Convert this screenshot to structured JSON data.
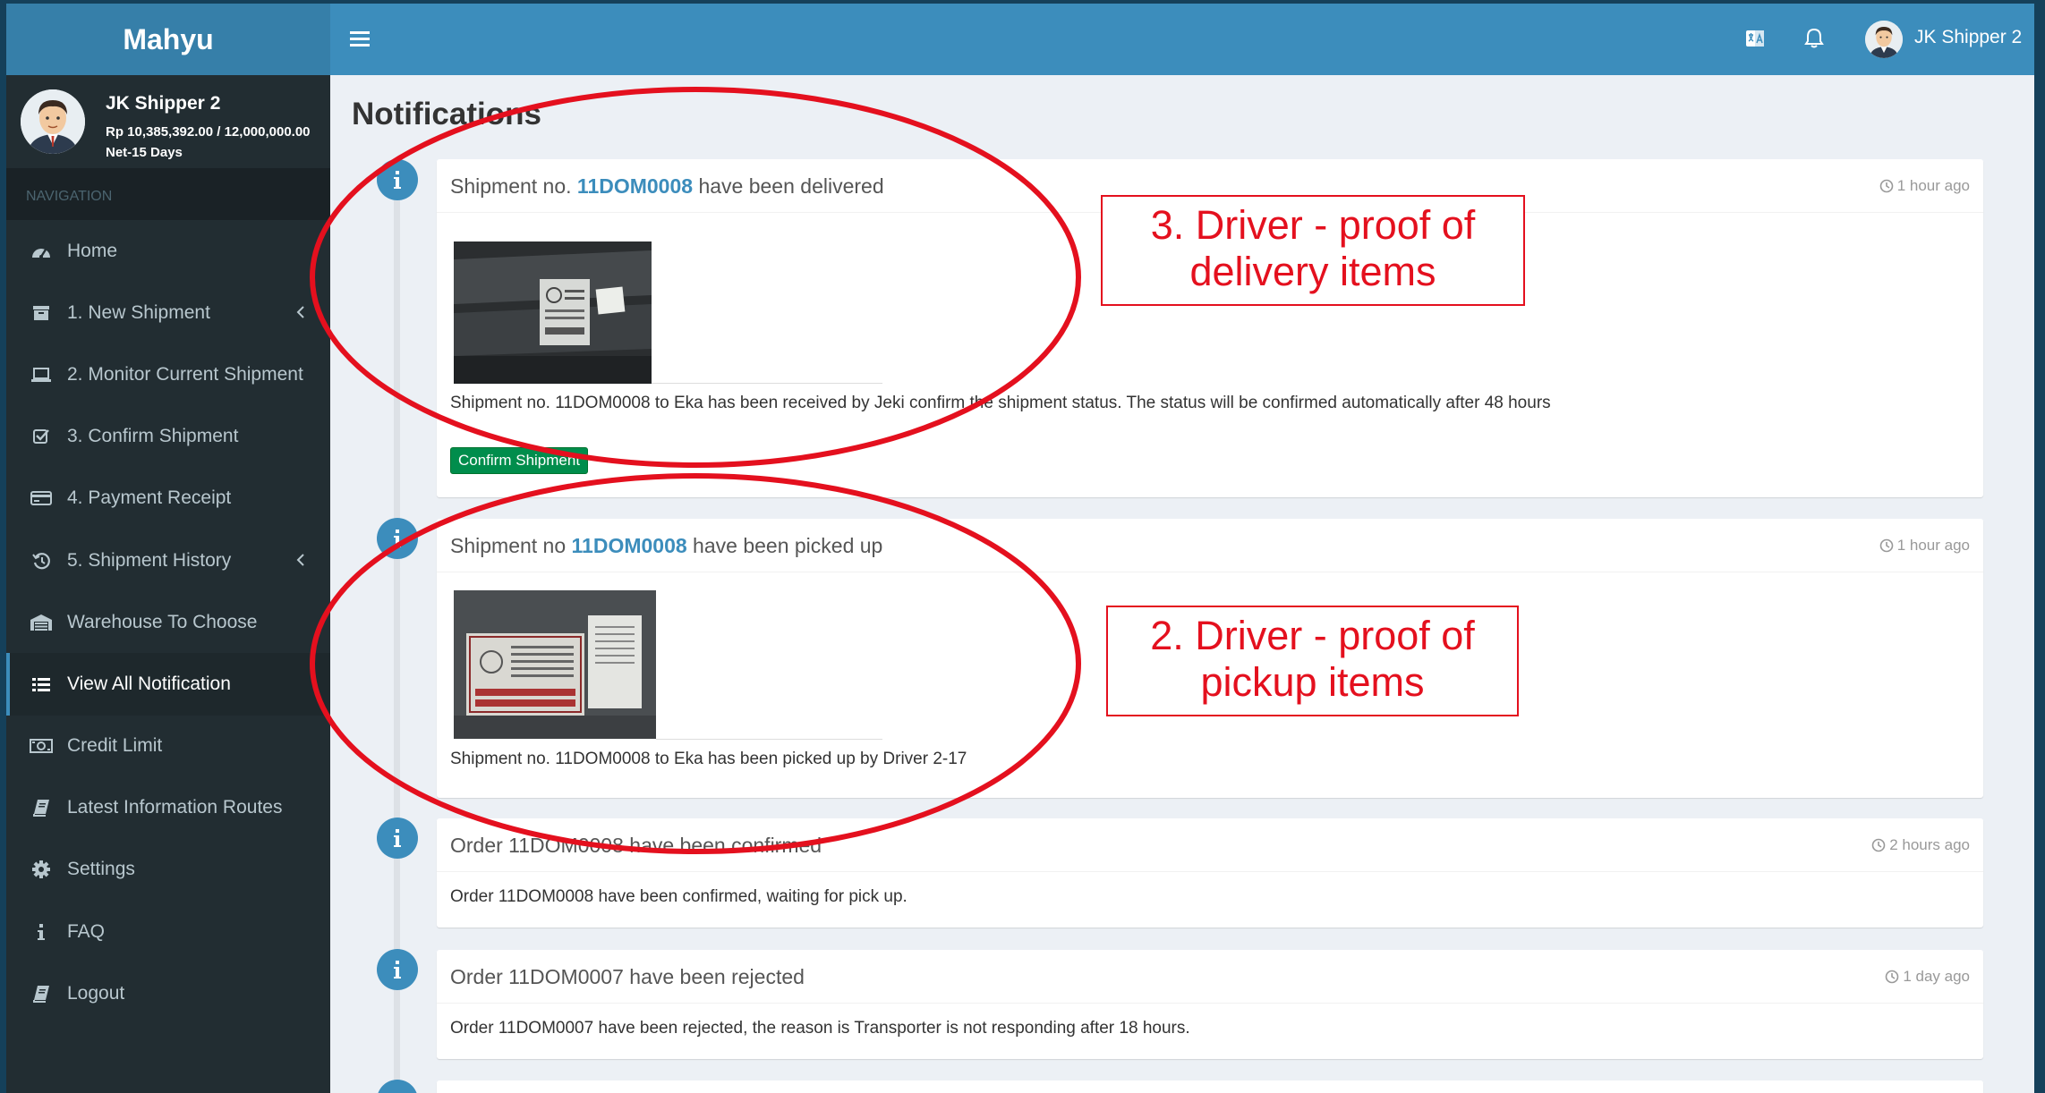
{
  "app": {
    "title": "Mahyu"
  },
  "user_panel": {
    "name": "JK Shipper 2",
    "credit": "Rp 10,385,392.00 / 12,000,000.00",
    "terms": "Net-15 Days"
  },
  "sidebar": {
    "header": "NAVIGATION",
    "items": [
      {
        "label": "Home",
        "icon": "dashboard-icon"
      },
      {
        "label": "1. New Shipment",
        "icon": "archive-icon",
        "chevron": true
      },
      {
        "label": "2. Monitor Current Shipment",
        "icon": "laptop-icon"
      },
      {
        "label": "3. Confirm Shipment",
        "icon": "check-square-icon"
      },
      {
        "label": "4. Payment Receipt",
        "icon": "credit-card-icon"
      },
      {
        "label": "5. Shipment History",
        "icon": "history-icon",
        "chevron": true
      },
      {
        "label": "Warehouse To Choose",
        "icon": "warehouse-icon"
      },
      {
        "label": "View All Notification",
        "icon": "list-icon",
        "active": true
      },
      {
        "label": "Credit Limit",
        "icon": "money-icon"
      },
      {
        "label": "Latest Information Routes",
        "icon": "book-icon"
      },
      {
        "label": "Settings",
        "icon": "gear-icon"
      },
      {
        "label": "FAQ",
        "icon": "info-icon"
      },
      {
        "label": "Logout",
        "icon": "book-icon"
      }
    ]
  },
  "topbar": {
    "username": "JK Shipper 2"
  },
  "page": {
    "title": "Notifications"
  },
  "notifications": [
    {
      "title_prefix": "Shipment no. ",
      "shipment_id": "11DOM0008",
      "title_suffix": " have been delivered",
      "time": "1 hour ago",
      "text": "Shipment no. 11DOM0008 to Eka has been received by Jeki confirm the shipment status. The status will be confirmed automatically after 48 hours",
      "button": "Confirm Shipment"
    },
    {
      "title_prefix": "Shipment no ",
      "shipment_id": "11DOM0008",
      "title_suffix": " have been picked up",
      "time": "1 hour ago",
      "text": "Shipment no. 11DOM0008 to Eka has been picked up by Driver 2-17"
    },
    {
      "title": "Order 11DOM0008 have been confirmed",
      "time": "2 hours ago",
      "text": "Order 11DOM0008 have been confirmed, waiting for pick up."
    },
    {
      "title": "Order 11DOM0007 have been rejected",
      "time": "1 day ago",
      "text": "Order 11DOM0007 have been rejected, the reason is Transporter is not responding after 18 hours."
    }
  ],
  "annotations": {
    "delivery": "3. Driver - proof of delivery items",
    "pickup": "2. Driver - proof of pickup items",
    "color": "#e4101e"
  },
  "colors": {
    "header": "#3c8dbc",
    "sidebar": "#222d32",
    "confirm_button": "#008d4c"
  }
}
